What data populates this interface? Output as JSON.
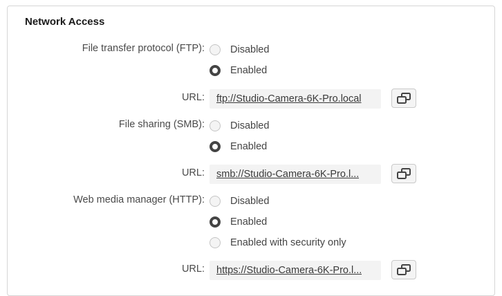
{
  "network_access": {
    "title": "Network Access",
    "ftp": {
      "label": "File transfer protocol (FTP):",
      "options": [
        "Disabled",
        "Enabled"
      ],
      "selected": "Enabled",
      "url_label": "URL:",
      "url": "ftp://Studio-Camera-6K-Pro.local"
    },
    "smb": {
      "label": "File sharing (SMB):",
      "options": [
        "Disabled",
        "Enabled"
      ],
      "selected": "Enabled",
      "url_label": "URL:",
      "url": "smb://Studio-Camera-6K-Pro.l..."
    },
    "http": {
      "label": "Web media manager (HTTP):",
      "options": [
        "Disabled",
        "Enabled",
        "Enabled with security only"
      ],
      "selected": "Enabled",
      "url_label": "URL:",
      "url": "https://Studio-Camera-6K-Pro.l..."
    }
  },
  "icons": {
    "copy": "copy-icon"
  }
}
